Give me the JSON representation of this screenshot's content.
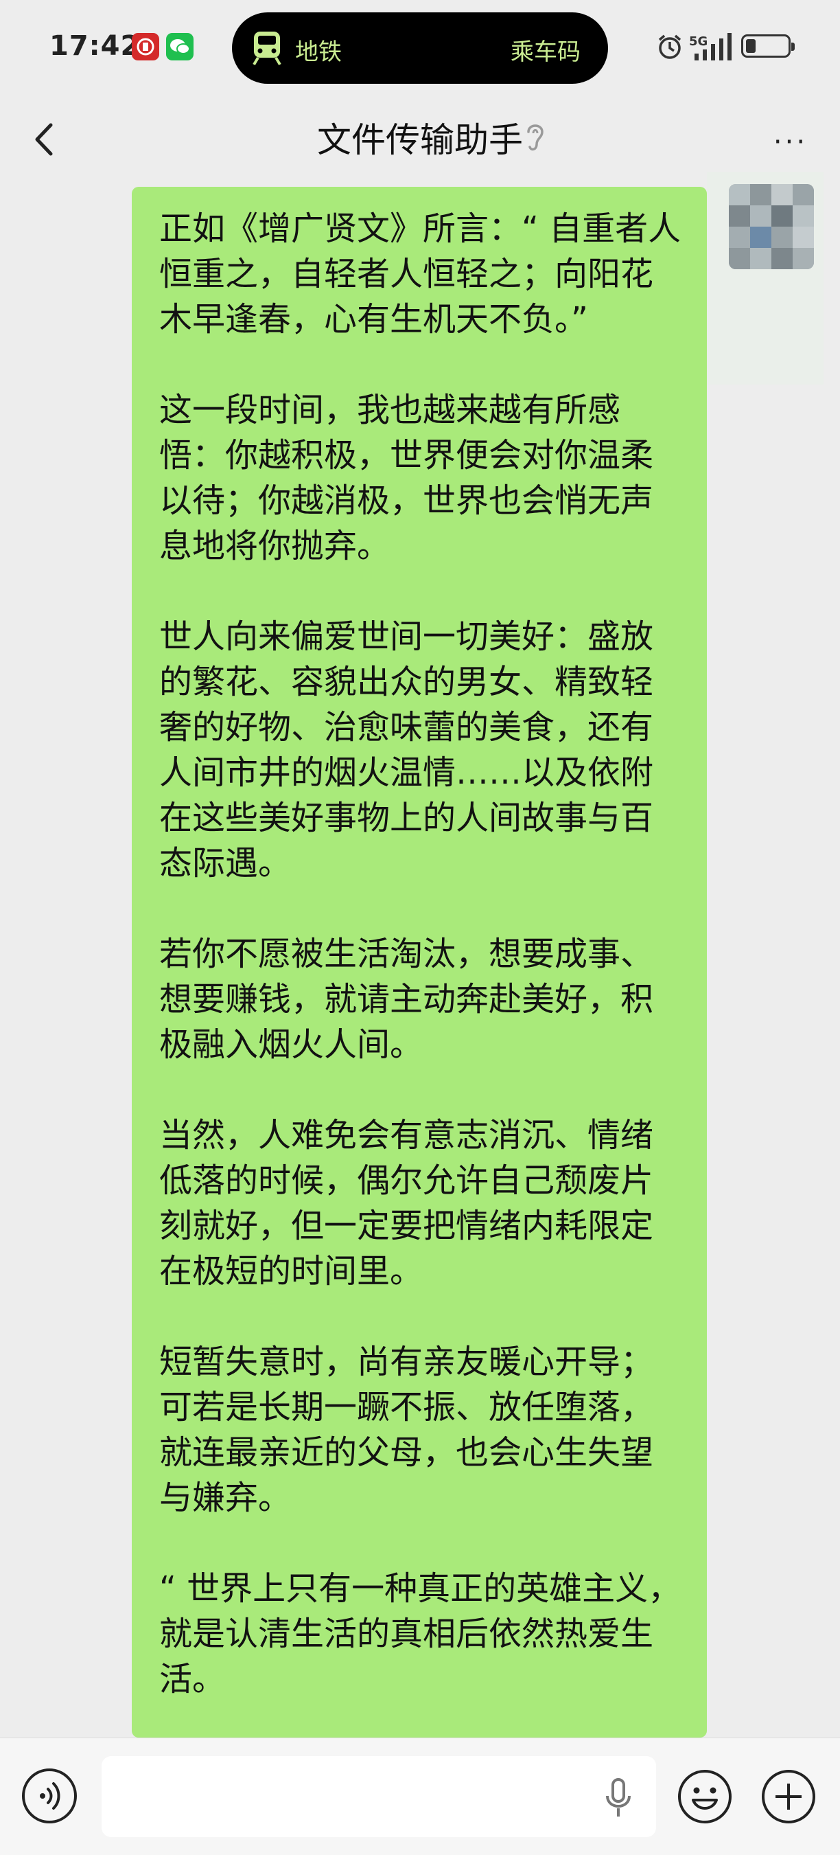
{
  "status_bar": {
    "time": "17:42",
    "pill_left_label": "地铁",
    "pill_right_label": "乘车码",
    "network": "5G",
    "accent_color": "#c9ec91"
  },
  "header": {
    "title": "文件传输助手"
  },
  "message": {
    "bubble_color": "#a9ea7a",
    "paragraphs": [
      "正如《增广贤文》所言：“ 自重者人恒重之，自轻者人恒轻之；向阳花木早逢春，心有生机天不负。”",
      "这一段时间，我也越来越有所感悟：你越积极，世界便会对你温柔以待；你越消极，世界也会悄无声息地将你抛弃。",
      "世人向来偏爱世间一切美好：盛放的繁花、容貌出众的男女、精致轻奢的好物、治愈味蕾的美食，还有人间市井的烟火温情……以及依附在这些美好事物上的人间故事与百态际遇。",
      "若你不愿被生活淘汰，想要成事、想要赚钱，就请主动奔赴美好，积极融入烟火人间。",
      "当然，人难免会有意志消沉、情绪低落的时候，偶尔允许自己颓废片刻就好，但一定要把情绪内耗限定在极短的时间里。",
      "短暂失意时，尚有亲友暖心开导；可若是长期一蹶不振、放任堕落，就连最亲近的父母，也会心生失望与嫌弃。",
      "“ 世界上只有一种真正的英雄主义，就是认清生活的真相后依然热爱生活。"
    ]
  },
  "input_bar": {
    "value": "",
    "placeholder": ""
  }
}
